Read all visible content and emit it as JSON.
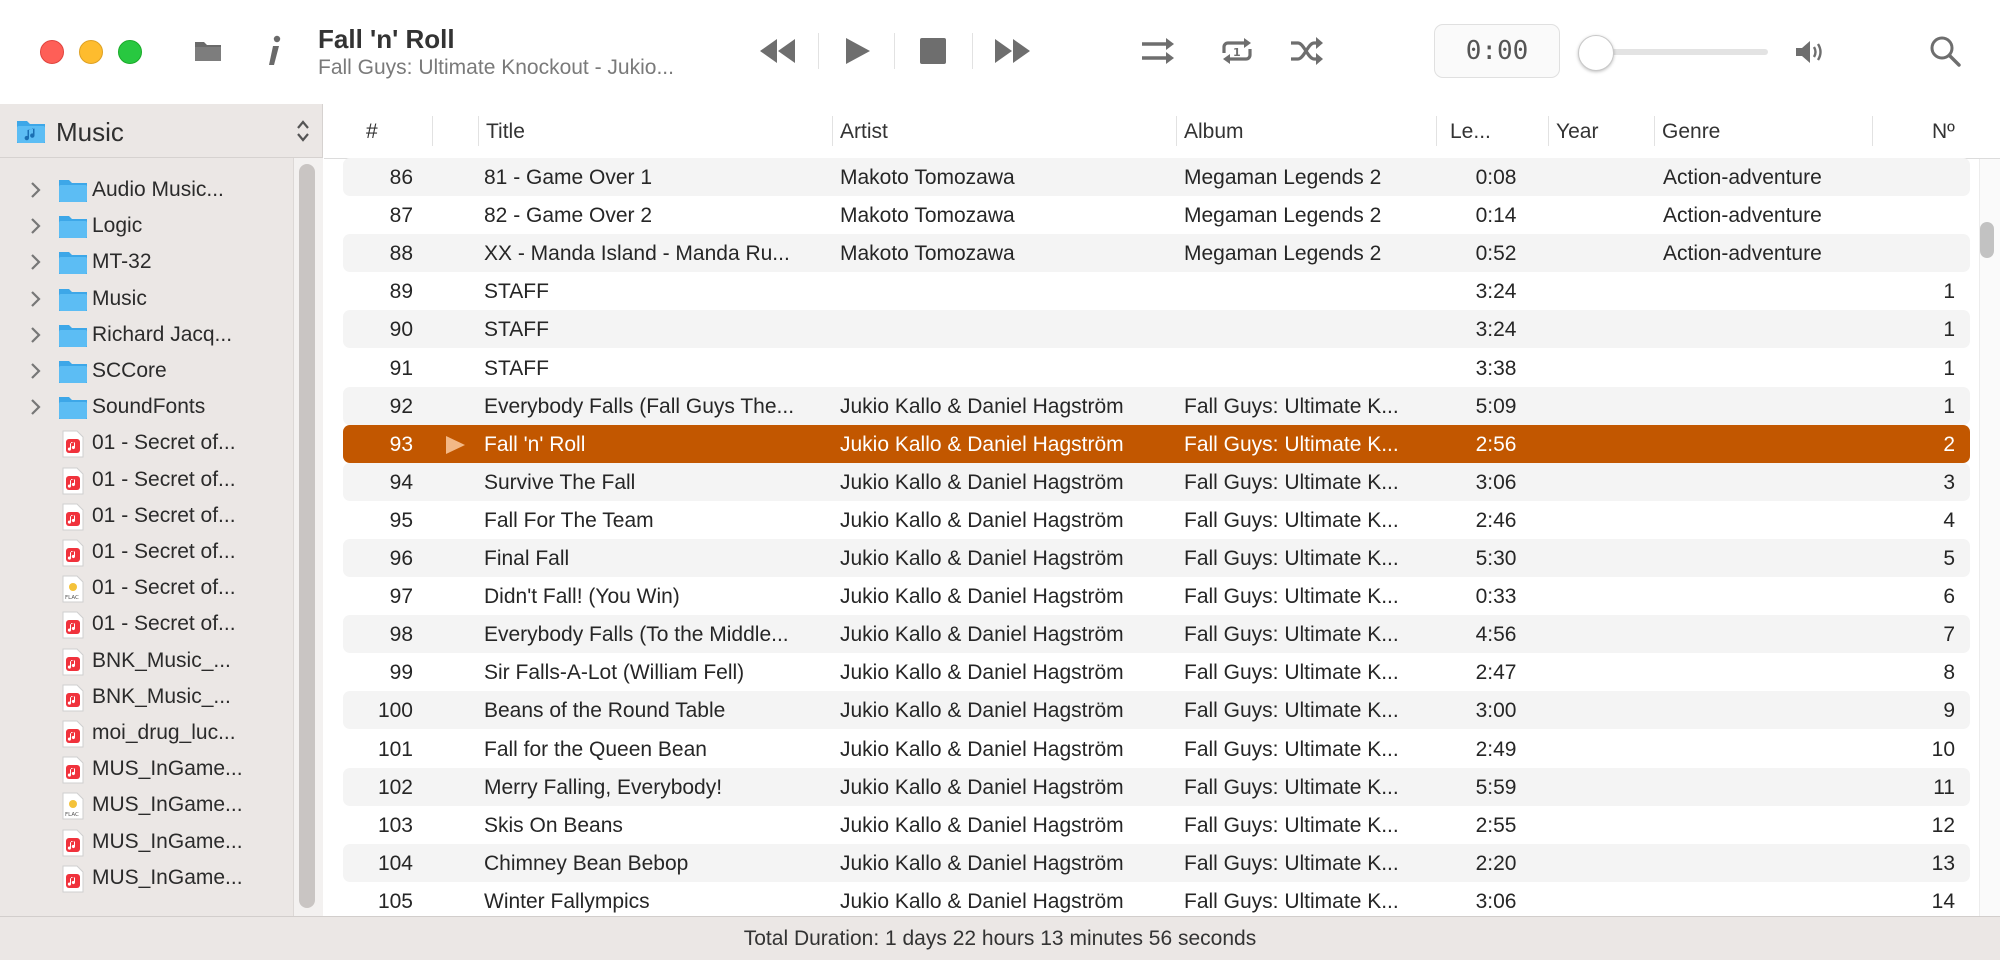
{
  "window": {
    "now_playing_title": "Fall 'n' Roll",
    "now_playing_subtitle": "Fall Guys: Ultimate Knockout - Jukio...",
    "time": "0:00",
    "volume": 0.0
  },
  "toolbar_icons": [
    "folder-icon",
    "info-icon",
    "rewind-icon",
    "play-icon",
    "stop-icon",
    "fast-forward-icon",
    "sequential-icon",
    "repeat-one-icon",
    "shuffle-icon",
    "volume-icon",
    "search-icon"
  ],
  "sidebar": {
    "source": "Music",
    "items": [
      {
        "label": "Audio Music...",
        "kind": "folder"
      },
      {
        "label": "Logic",
        "kind": "folder"
      },
      {
        "label": "MT-32",
        "kind": "folder"
      },
      {
        "label": "Music",
        "kind": "folder"
      },
      {
        "label": "Richard Jacq...",
        "kind": "folder"
      },
      {
        "label": "SCCore",
        "kind": "folder"
      },
      {
        "label": "SoundFonts",
        "kind": "folder"
      },
      {
        "label": "01 - Secret of...",
        "kind": "music"
      },
      {
        "label": "01 - Secret of...",
        "kind": "music"
      },
      {
        "label": "01 - Secret of...",
        "kind": "music"
      },
      {
        "label": "01 - Secret of...",
        "kind": "music"
      },
      {
        "label": "01 - Secret of...",
        "kind": "flac"
      },
      {
        "label": "01 - Secret of...",
        "kind": "music"
      },
      {
        "label": "BNK_Music_...",
        "kind": "music"
      },
      {
        "label": "BNK_Music_...",
        "kind": "music"
      },
      {
        "label": "moi_drug_luc...",
        "kind": "music"
      },
      {
        "label": "MUS_InGame...",
        "kind": "music"
      },
      {
        "label": "MUS_InGame...",
        "kind": "flac"
      },
      {
        "label": "MUS_InGame...",
        "kind": "music"
      },
      {
        "label": "MUS_InGame...",
        "kind": "music"
      }
    ]
  },
  "table": {
    "columns": {
      "num": "#",
      "title": "Title",
      "artist": "Artist",
      "album": "Album",
      "length": "Le...",
      "year": "Year",
      "genre": "Genre",
      "track": "Nº"
    },
    "rows": [
      {
        "num": "86",
        "title": "81 - Game Over 1",
        "artist": "Makoto Tomozawa",
        "album": "Megaman Legends 2",
        "length": "0:08",
        "year": "",
        "genre": "Action-adventure",
        "track": ""
      },
      {
        "num": "87",
        "title": "82 - Game Over 2",
        "artist": "Makoto Tomozawa",
        "album": "Megaman Legends 2",
        "length": "0:14",
        "year": "",
        "genre": "Action-adventure",
        "track": ""
      },
      {
        "num": "88",
        "title": "XX - Manda Island - Manda Ru...",
        "artist": "Makoto Tomozawa",
        "album": "Megaman Legends 2",
        "length": "0:52",
        "year": "",
        "genre": "Action-adventure",
        "track": ""
      },
      {
        "num": "89",
        "title": "STAFF",
        "artist": "",
        "album": "",
        "length": "3:24",
        "year": "",
        "genre": "",
        "track": "1"
      },
      {
        "num": "90",
        "title": "STAFF",
        "artist": "",
        "album": "",
        "length": "3:24",
        "year": "",
        "genre": "",
        "track": "1"
      },
      {
        "num": "91",
        "title": "STAFF",
        "artist": "",
        "album": "",
        "length": "3:38",
        "year": "",
        "genre": "",
        "track": "1"
      },
      {
        "num": "92",
        "title": "Everybody Falls (Fall Guys The...",
        "artist": "Jukio Kallo & Daniel Hagström",
        "album": "Fall Guys: Ultimate K...",
        "length": "5:09",
        "year": "",
        "genre": "",
        "track": "1"
      },
      {
        "num": "93",
        "title": "Fall 'n' Roll",
        "artist": "Jukio Kallo & Daniel Hagström",
        "album": "Fall Guys: Ultimate K...",
        "length": "2:56",
        "year": "",
        "genre": "",
        "track": "2",
        "playing": true
      },
      {
        "num": "94",
        "title": "Survive The Fall",
        "artist": "Jukio Kallo & Daniel Hagström",
        "album": "Fall Guys: Ultimate K...",
        "length": "3:06",
        "year": "",
        "genre": "",
        "track": "3"
      },
      {
        "num": "95",
        "title": "Fall For The Team",
        "artist": "Jukio Kallo & Daniel Hagström",
        "album": "Fall Guys: Ultimate K...",
        "length": "2:46",
        "year": "",
        "genre": "",
        "track": "4"
      },
      {
        "num": "96",
        "title": "Final Fall",
        "artist": "Jukio Kallo & Daniel Hagström",
        "album": "Fall Guys: Ultimate K...",
        "length": "5:30",
        "year": "",
        "genre": "",
        "track": "5"
      },
      {
        "num": "97",
        "title": "Didn't Fall! (You Win)",
        "artist": "Jukio Kallo & Daniel Hagström",
        "album": "Fall Guys: Ultimate K...",
        "length": "0:33",
        "year": "",
        "genre": "",
        "track": "6"
      },
      {
        "num": "98",
        "title": "Everybody Falls (To the Middle...",
        "artist": "Jukio Kallo & Daniel Hagström",
        "album": "Fall Guys: Ultimate K...",
        "length": "4:56",
        "year": "",
        "genre": "",
        "track": "7"
      },
      {
        "num": "99",
        "title": "Sir Falls-A-Lot (William Fell)",
        "artist": "Jukio Kallo & Daniel Hagström",
        "album": "Fall Guys: Ultimate K...",
        "length": "2:47",
        "year": "",
        "genre": "",
        "track": "8"
      },
      {
        "num": "100",
        "title": "Beans of the Round Table",
        "artist": "Jukio Kallo & Daniel Hagström",
        "album": "Fall Guys: Ultimate K...",
        "length": "3:00",
        "year": "",
        "genre": "",
        "track": "9"
      },
      {
        "num": "101",
        "title": "Fall for the Queen Bean",
        "artist": "Jukio Kallo & Daniel Hagström",
        "album": "Fall Guys: Ultimate K...",
        "length": "2:49",
        "year": "",
        "genre": "",
        "track": "10"
      },
      {
        "num": "102",
        "title": "Merry Falling, Everybody!",
        "artist": "Jukio Kallo & Daniel Hagström",
        "album": "Fall Guys: Ultimate K...",
        "length": "5:59",
        "year": "",
        "genre": "",
        "track": "11"
      },
      {
        "num": "103",
        "title": "Skis On Beans",
        "artist": "Jukio Kallo & Daniel Hagström",
        "album": "Fall Guys: Ultimate K...",
        "length": "2:55",
        "year": "",
        "genre": "",
        "track": "12"
      },
      {
        "num": "104",
        "title": "Chimney Bean Bebop",
        "artist": "Jukio Kallo & Daniel Hagström",
        "album": "Fall Guys: Ultimate K...",
        "length": "2:20",
        "year": "",
        "genre": "",
        "track": "13"
      },
      {
        "num": "105",
        "title": "Winter Fallympics",
        "artist": "Jukio Kallo & Daniel Hagström",
        "album": "Fall Guys: Ultimate K...",
        "length": "3:06",
        "year": "",
        "genre": "",
        "track": "14"
      }
    ]
  },
  "status": {
    "total_duration": "Total Duration: 1 days 22 hours 13 minutes 56 seconds"
  },
  "colors": {
    "selection": "#c25700",
    "folder": "#4fb6f0",
    "music_file": "#f0323c"
  }
}
